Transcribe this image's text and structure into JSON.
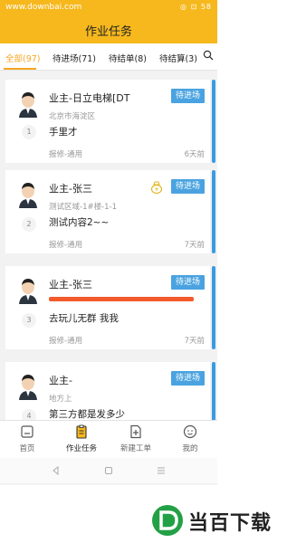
{
  "status_bar": {
    "url": "www.downbai.com",
    "right": "◎ ⊡ 58"
  },
  "header": {
    "title": "作业任务"
  },
  "tabs": [
    {
      "label": "全部(97)"
    },
    {
      "label": "待进场(71)"
    },
    {
      "label": "待结单(8)"
    },
    {
      "label": "待结算(3)"
    }
  ],
  "cards": [
    {
      "title": "业主-日立电梯[DT",
      "subtitle": "北京市海淀区",
      "number": "1",
      "content": "手里才",
      "category": "报修-通用",
      "time": "6天前",
      "status": "待进场"
    },
    {
      "title": "业主-张三",
      "subtitle": "测试区域-1#楼-1-1",
      "number": "2",
      "content": "测试内容2~~",
      "category": "报修-通用",
      "time": "7天前",
      "status": "待进场"
    },
    {
      "title": "业主-张三",
      "subtitle": "",
      "number": "3",
      "content": "去玩儿无群 我我",
      "category": "报修-通用",
      "time": "7天前",
      "status": "待进场"
    },
    {
      "title": "业主-",
      "subtitle": "地方上",
      "number": "4",
      "content": "第三方都是发多少",
      "category": "",
      "time": "",
      "status": "待进场"
    }
  ],
  "bottom_nav": [
    {
      "label": "首页"
    },
    {
      "label": "作业任务"
    },
    {
      "label": "新建工单"
    },
    {
      "label": "我的"
    }
  ],
  "watermark": {
    "text": "当百下载"
  },
  "colors": {
    "accent": "#f6b81d",
    "tab_active": "#f5a623",
    "badge": "#4aa3e0",
    "card_bar": "#3a9be0"
  }
}
